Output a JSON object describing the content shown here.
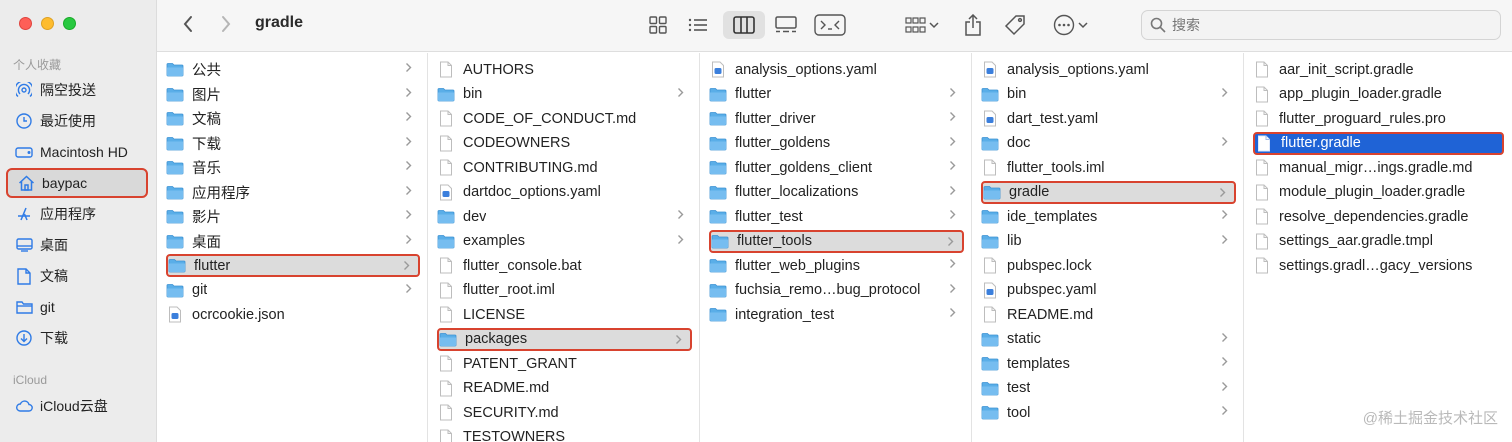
{
  "window": {
    "title": "gradle"
  },
  "search": {
    "placeholder": "搜索"
  },
  "sidebar": {
    "favorites_label": "个人收藏",
    "favorites": [
      {
        "label": "隔空投送",
        "icon": "airdrop-icon"
      },
      {
        "label": "最近使用",
        "icon": "clock-icon"
      },
      {
        "label": "Macintosh HD",
        "icon": "disk-icon"
      },
      {
        "label": "baypac",
        "icon": "home-icon",
        "selected": true
      },
      {
        "label": "应用程序",
        "icon": "applications-icon"
      },
      {
        "label": "桌面",
        "icon": "desktop-icon"
      },
      {
        "label": "文稿",
        "icon": "document-icon"
      },
      {
        "label": "git",
        "icon": "folder-icon"
      },
      {
        "label": "下载",
        "icon": "download-icon"
      }
    ],
    "icloud_label": "iCloud",
    "icloud": [
      {
        "label": "iCloud云盘",
        "icon": "cloud-icon"
      }
    ]
  },
  "columns": [
    {
      "items": [
        {
          "label": "公共",
          "type": "folder",
          "chevron": true
        },
        {
          "label": "图片",
          "type": "folder",
          "chevron": true
        },
        {
          "label": "文稿",
          "type": "folder",
          "chevron": true
        },
        {
          "label": "下载",
          "type": "folder",
          "chevron": true
        },
        {
          "label": "音乐",
          "type": "folder",
          "chevron": true
        },
        {
          "label": "应用程序",
          "type": "folder",
          "chevron": true
        },
        {
          "label": "影片",
          "type": "folder",
          "chevron": true
        },
        {
          "label": "桌面",
          "type": "folder",
          "chevron": true
        },
        {
          "label": "flutter",
          "type": "folder",
          "chevron": true,
          "state": "highlighted"
        },
        {
          "label": "git",
          "type": "folder",
          "chevron": true
        },
        {
          "label": "ocrcookie.json",
          "type": "file"
        }
      ]
    },
    {
      "items": [
        {
          "label": "AUTHORS",
          "type": "file"
        },
        {
          "label": "bin",
          "type": "folder",
          "chevron": true
        },
        {
          "label": "CODE_OF_CONDUCT.md",
          "type": "file"
        },
        {
          "label": "CODEOWNERS",
          "type": "file"
        },
        {
          "label": "CONTRIBUTING.md",
          "type": "file"
        },
        {
          "label": "dartdoc_options.yaml",
          "type": "file"
        },
        {
          "label": "dev",
          "type": "folder",
          "chevron": true
        },
        {
          "label": "examples",
          "type": "folder",
          "chevron": true
        },
        {
          "label": "flutter_console.bat",
          "type": "file"
        },
        {
          "label": "flutter_root.iml",
          "type": "file"
        },
        {
          "label": "LICENSE",
          "type": "file"
        },
        {
          "label": "packages",
          "type": "folder",
          "chevron": true,
          "state": "highlighted"
        },
        {
          "label": "PATENT_GRANT",
          "type": "file"
        },
        {
          "label": "README.md",
          "type": "file"
        },
        {
          "label": "SECURITY.md",
          "type": "file"
        },
        {
          "label": "TESTOWNERS",
          "type": "file"
        }
      ]
    },
    {
      "items": [
        {
          "label": "analysis_options.yaml",
          "type": "file"
        },
        {
          "label": "flutter",
          "type": "folder",
          "chevron": true
        },
        {
          "label": "flutter_driver",
          "type": "folder",
          "chevron": true
        },
        {
          "label": "flutter_goldens",
          "type": "folder",
          "chevron": true
        },
        {
          "label": "flutter_goldens_client",
          "type": "folder",
          "chevron": true
        },
        {
          "label": "flutter_localizations",
          "type": "folder",
          "chevron": true
        },
        {
          "label": "flutter_test",
          "type": "folder",
          "chevron": true
        },
        {
          "label": "flutter_tools",
          "type": "folder",
          "chevron": true,
          "state": "highlighted"
        },
        {
          "label": "flutter_web_plugins",
          "type": "folder",
          "chevron": true
        },
        {
          "label": "fuchsia_remo…bug_protocol",
          "type": "folder",
          "chevron": true
        },
        {
          "label": "integration_test",
          "type": "folder",
          "chevron": true
        }
      ]
    },
    {
      "items": [
        {
          "label": "analysis_options.yaml",
          "type": "file"
        },
        {
          "label": "bin",
          "type": "folder",
          "chevron": true
        },
        {
          "label": "dart_test.yaml",
          "type": "file"
        },
        {
          "label": "doc",
          "type": "folder",
          "chevron": true
        },
        {
          "label": "flutter_tools.iml",
          "type": "file"
        },
        {
          "label": "gradle",
          "type": "folder",
          "chevron": true,
          "state": "highlighted"
        },
        {
          "label": "ide_templates",
          "type": "folder",
          "chevron": true
        },
        {
          "label": "lib",
          "type": "folder",
          "chevron": true
        },
        {
          "label": "pubspec.lock",
          "type": "file"
        },
        {
          "label": "pubspec.yaml",
          "type": "file"
        },
        {
          "label": "README.md",
          "type": "file"
        },
        {
          "label": "static",
          "type": "folder",
          "chevron": true
        },
        {
          "label": "templates",
          "type": "folder",
          "chevron": true
        },
        {
          "label": "test",
          "type": "folder",
          "chevron": true
        },
        {
          "label": "tool",
          "type": "folder",
          "chevron": true
        }
      ]
    },
    {
      "items": [
        {
          "label": "aar_init_script.gradle",
          "type": "file"
        },
        {
          "label": "app_plugin_loader.gradle",
          "type": "file"
        },
        {
          "label": "flutter_proguard_rules.pro",
          "type": "file"
        },
        {
          "label": "flutter.gradle",
          "type": "file",
          "state": "selected"
        },
        {
          "label": "manual_migr…ings.gradle.md",
          "type": "file"
        },
        {
          "label": "module_plugin_loader.gradle",
          "type": "file"
        },
        {
          "label": "resolve_dependencies.gradle",
          "type": "file"
        },
        {
          "label": "settings_aar.gradle.tmpl",
          "type": "file"
        },
        {
          "label": "settings.gradl…gacy_versions",
          "type": "file"
        }
      ]
    }
  ],
  "watermark": "@稀土掘金技术社区",
  "colors": {
    "accent": "#1f63d6",
    "highlight_border": "#d8432f",
    "folder": "#5aaee8"
  }
}
